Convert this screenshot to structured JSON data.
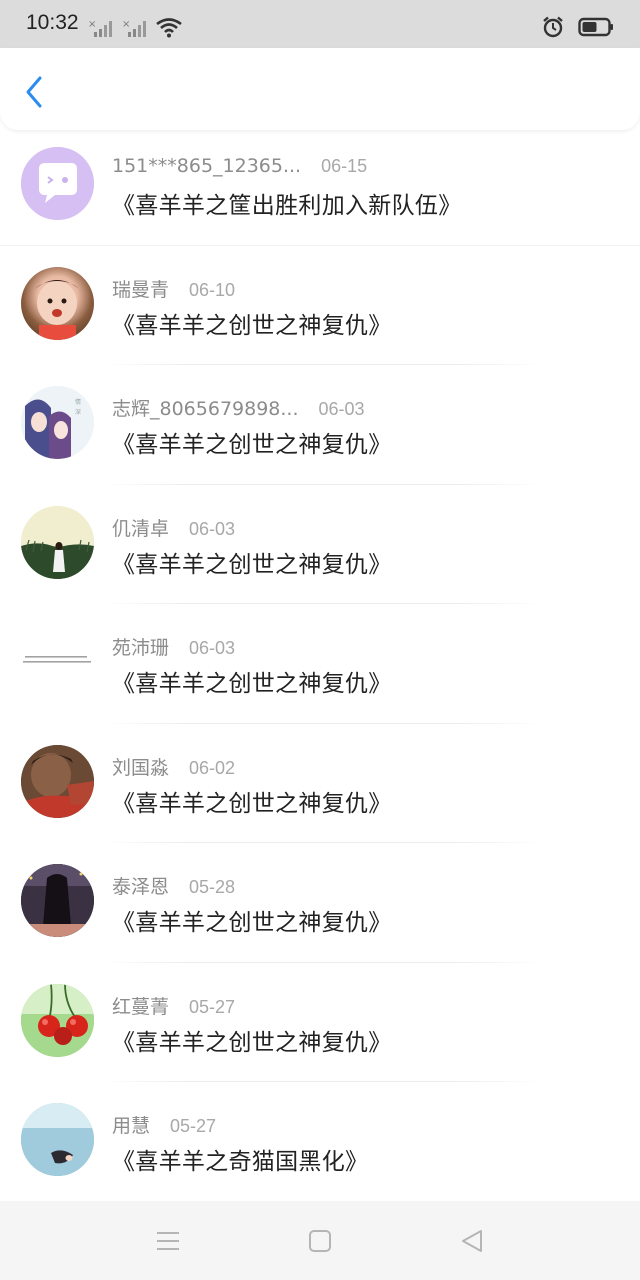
{
  "status_bar": {
    "time": "10:32",
    "icons": [
      "signal-1-no-service-icon",
      "signal-2-no-service-icon",
      "wifi-icon",
      "alarm-icon",
      "battery-icon"
    ]
  },
  "header": {
    "back_icon": "chevron-left-icon",
    "accent_color": "#2a8cf0"
  },
  "items": [
    {
      "name": "151***865_12365...",
      "date": "06-15",
      "title": "《喜羊羊之筐出胜利加入新队伍》",
      "avatar": "default-chat-bubble"
    },
    {
      "name": "瑞曼青",
      "date": "06-10",
      "title": "《喜羊羊之创世之神复仇》",
      "avatar": "baby-photo"
    },
    {
      "name": "志辉_8065679898...",
      "date": "06-03",
      "title": "《喜羊羊之创世之神复仇》",
      "avatar": "anime-girls"
    },
    {
      "name": "仉清卓",
      "date": "06-03",
      "title": "《喜羊羊之创世之神复仇》",
      "avatar": "girl-in-field"
    },
    {
      "name": "苑沛珊",
      "date": "06-03",
      "title": "《喜羊羊之创世之神复仇》",
      "avatar": "text-image"
    },
    {
      "name": "刘国淼",
      "date": "06-02",
      "title": "《喜羊羊之创世之神复仇》",
      "avatar": "man-photo"
    },
    {
      "name": "泰泽恩",
      "date": "05-28",
      "title": "《喜羊羊之创世之神复仇》",
      "avatar": "long-hair-girl"
    },
    {
      "name": "红蔓菁",
      "date": "05-27",
      "title": "《喜羊羊之创世之神复仇》",
      "avatar": "cherries"
    },
    {
      "name": "用慧",
      "date": "05-27",
      "title": "《喜羊羊之奇猫国黑化》",
      "avatar": "underwater"
    }
  ],
  "nav_bar": {
    "icons": [
      "menu-icon",
      "home-square-icon",
      "back-triangle-icon"
    ]
  }
}
